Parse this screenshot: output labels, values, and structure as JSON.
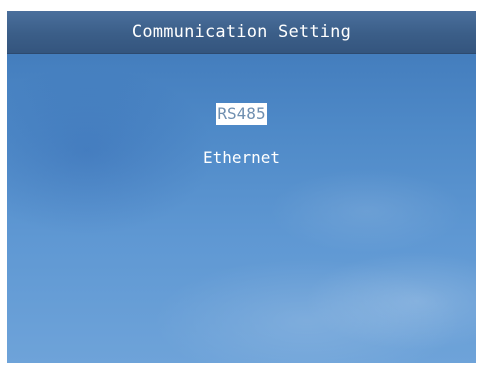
{
  "window": {
    "title": "Communication Setting"
  },
  "menu": {
    "items": [
      {
        "label": "RS485",
        "selected": true
      },
      {
        "label": "Ethernet",
        "selected": false
      }
    ]
  },
  "colors": {
    "titlebar": "#3b5e88",
    "background_sky": "#4f8ac8",
    "text": "#ffffff",
    "selection_highlight": "#ffffff",
    "selection_text": "#6f8fb0"
  }
}
